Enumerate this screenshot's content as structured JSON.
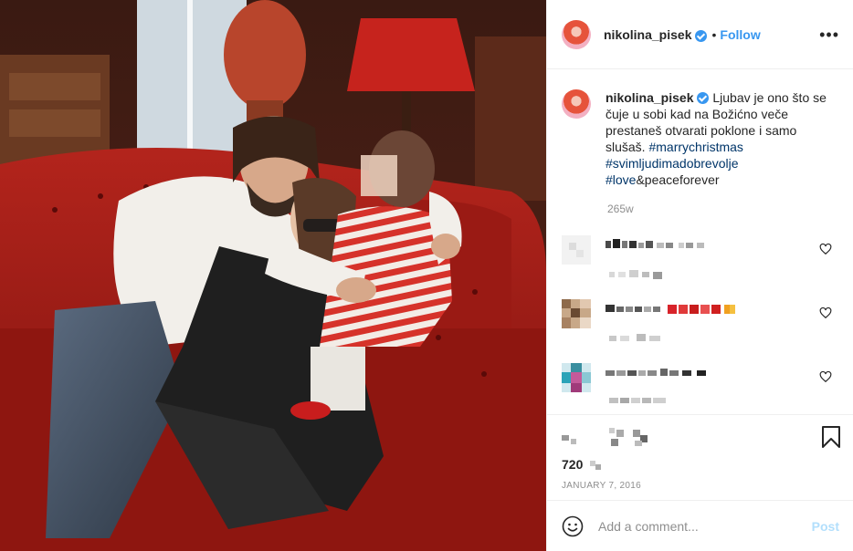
{
  "header": {
    "username": "nikolina_pisek",
    "separator": "•",
    "follow_label": "Follow",
    "more_label": "•••"
  },
  "caption": {
    "username": "nikolina_pisek",
    "text": "Ljubav je ono što se čuje u sobi kad na Božićno veče prestaneš otvarati poklone i samo slušaš.",
    "hashtags": [
      "#marrychristmas",
      "#svimljudimadobrevolje",
      "#love"
    ],
    "tail": "&peaceforever",
    "time_ago": "265w"
  },
  "engagement": {
    "likes": "720",
    "date": "JANUARY 7, 2016"
  },
  "composer": {
    "placeholder": "Add a comment...",
    "post_label": "Post"
  },
  "icons": {
    "verified": "verified-badge-icon",
    "more": "more-options-icon",
    "heart": "heart-icon",
    "bookmark": "bookmark-icon",
    "emoji": "emoji-icon"
  },
  "colors": {
    "accent": "#3897f0",
    "hashtag": "#003569",
    "muted": "#8e8e8e",
    "post_disabled": "#b2dffc"
  }
}
